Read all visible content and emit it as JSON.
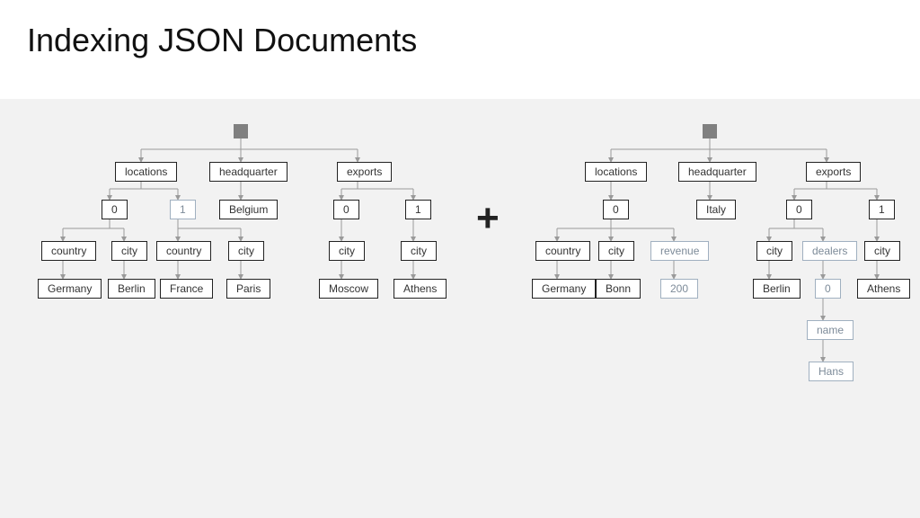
{
  "title": "Indexing JSON Documents",
  "plus_symbol": "+",
  "trees": {
    "left": {
      "row1": {
        "locations": "locations",
        "headquarter": "headquarter",
        "exports": "exports"
      },
      "row2": {
        "loc0": "0",
        "loc1": "1",
        "hq_val": "Belgium",
        "exp0": "0",
        "exp1": "1"
      },
      "row3": {
        "country_a": "country",
        "city_a": "city",
        "country_b": "country",
        "city_b": "city",
        "city_c": "city",
        "city_d": "city"
      },
      "row4": {
        "germany": "Germany",
        "berlin": "Berlin",
        "france": "France",
        "paris": "Paris",
        "moscow": "Moscow",
        "athens": "Athens"
      }
    },
    "right": {
      "row1": {
        "locations": "locations",
        "headquarter": "headquarter",
        "exports": "exports"
      },
      "row2": {
        "loc0": "0",
        "hq_val": "Italy",
        "exp0": "0",
        "exp1": "1"
      },
      "row3": {
        "country": "country",
        "city_a": "city",
        "revenue": "revenue",
        "city_b": "city",
        "dealers": "dealers",
        "city_c": "city"
      },
      "row4": {
        "germany": "Germany",
        "bonn": "Bonn",
        "v200": "200",
        "berlin": "Berlin",
        "d0": "0",
        "athens": "Athens"
      },
      "row5": {
        "name": "name"
      },
      "row6": {
        "hans": "Hans"
      }
    }
  }
}
